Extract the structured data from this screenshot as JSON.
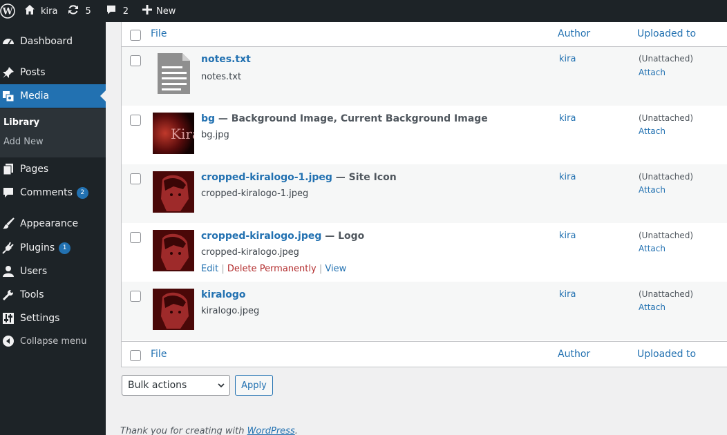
{
  "admin_bar": {
    "site_name": "kira",
    "updates_count": "5",
    "comments_count": "2",
    "new_label": "New"
  },
  "sidebar": {
    "items": [
      {
        "label": "Dashboard",
        "icon": "dashboard-icon"
      },
      {
        "label": "Posts",
        "icon": "pin-icon"
      },
      {
        "label": "Media",
        "icon": "media-icon"
      },
      {
        "label": "Pages",
        "icon": "pages-icon"
      },
      {
        "label": "Comments",
        "icon": "comment-icon",
        "badge": "2"
      },
      {
        "label": "Appearance",
        "icon": "paintbrush-icon"
      },
      {
        "label": "Plugins",
        "icon": "plugin-icon",
        "badge": "1"
      },
      {
        "label": "Users",
        "icon": "user-icon"
      },
      {
        "label": "Tools",
        "icon": "wrench-icon"
      },
      {
        "label": "Settings",
        "icon": "settings-icon"
      }
    ],
    "submenu": [
      "Library",
      "Add New"
    ],
    "collapse_label": "Collapse menu"
  },
  "table": {
    "columns": [
      "File",
      "Author",
      "Uploaded to"
    ],
    "rows": [
      {
        "title": "notes.txt",
        "suffix": "",
        "filename": "notes.txt",
        "author": "kira",
        "uploaded": "(Unattached)",
        "attach": "Attach"
      },
      {
        "title": "bg",
        "suffix": " — Background Image, Current Background Image",
        "filename": "bg.jpg",
        "author": "kira",
        "uploaded": "(Unattached)",
        "attach": "Attach"
      },
      {
        "title": "cropped-kiralogo-1.jpeg",
        "suffix": " — Site Icon",
        "filename": "cropped-kiralogo-1.jpeg",
        "author": "kira",
        "uploaded": "(Unattached)",
        "attach": "Attach"
      },
      {
        "title": "cropped-kiralogo.jpeg",
        "suffix": " — Logo",
        "filename": "cropped-kiralogo.jpeg",
        "author": "kira",
        "uploaded": "(Unattached)",
        "attach": "Attach",
        "actions": {
          "edit": "Edit",
          "delete": "Delete Permanently",
          "view": "View"
        }
      },
      {
        "title": "kiralogo",
        "suffix": "",
        "filename": "kiralogo.jpeg",
        "author": "kira",
        "uploaded": "(Unattached)",
        "attach": "Attach"
      }
    ]
  },
  "bulk": {
    "selected": "Bulk actions",
    "apply": "Apply"
  },
  "footer": {
    "text": "Thank you for creating with ",
    "link": "WordPress",
    "end": "."
  },
  "colors": {
    "accent": "#2271b1",
    "admin_dark": "#1d2327",
    "danger": "#b32d2e"
  }
}
